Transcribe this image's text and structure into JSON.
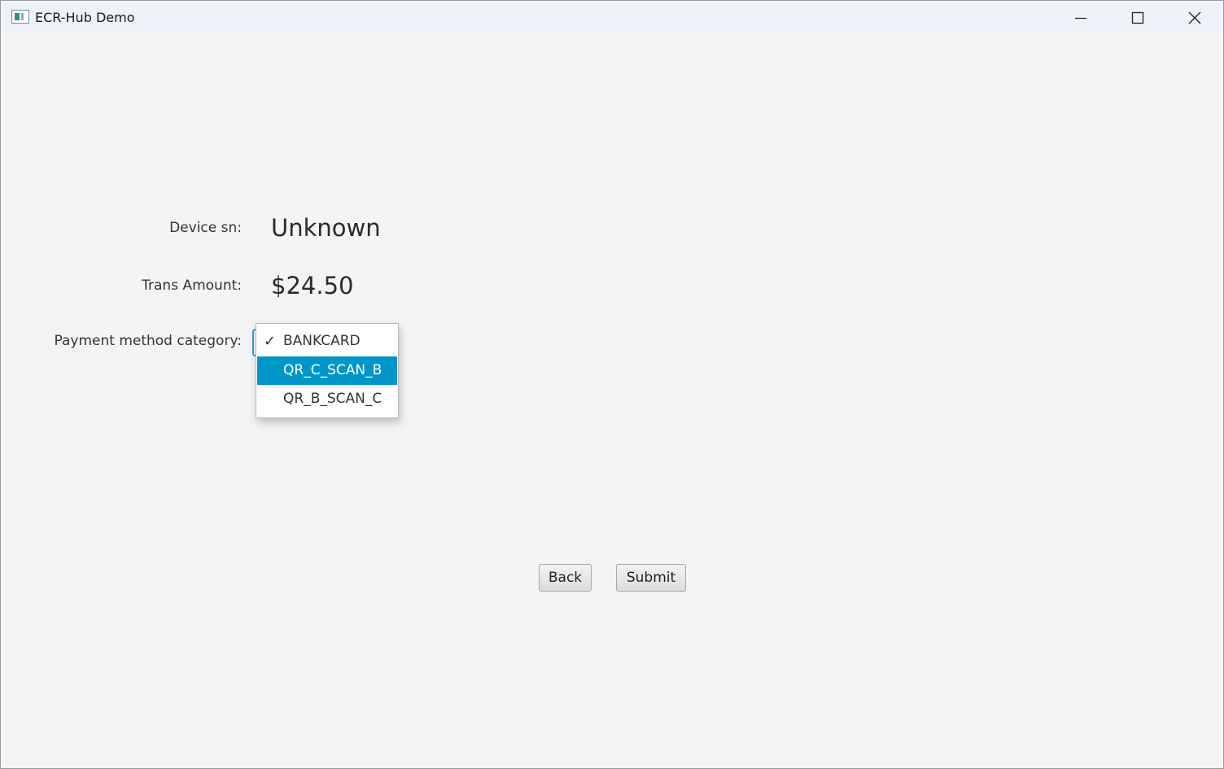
{
  "window": {
    "title": "ECR-Hub Demo",
    "app_icon": "app-window-icon",
    "controls": {
      "minimize_icon": "minimize-icon",
      "maximize_icon": "maximize-icon",
      "close_icon": "close-icon"
    }
  },
  "form": {
    "device_sn_label": "Device sn:",
    "device_sn_value": "Unknown",
    "trans_amount_label": "Trans Amount:",
    "trans_amount_value": "$24.50",
    "payment_category_label": "Payment method category:",
    "payment_category_selected": "BANKCARD",
    "payment_category_options": [
      {
        "label": "BANKCARD",
        "checked": true,
        "highlighted": false
      },
      {
        "label": "QR_C_SCAN_B",
        "checked": false,
        "highlighted": true
      },
      {
        "label": "QR_B_SCAN_C",
        "checked": false,
        "highlighted": false
      }
    ],
    "check_mark": "✓"
  },
  "actions": {
    "back_label": "Back",
    "submit_label": "Submit"
  },
  "colors": {
    "background": "#f4f4f4",
    "titlebar": "#eef3fa",
    "highlight": "#0096c9",
    "focus_border": "#2aa3d6"
  }
}
